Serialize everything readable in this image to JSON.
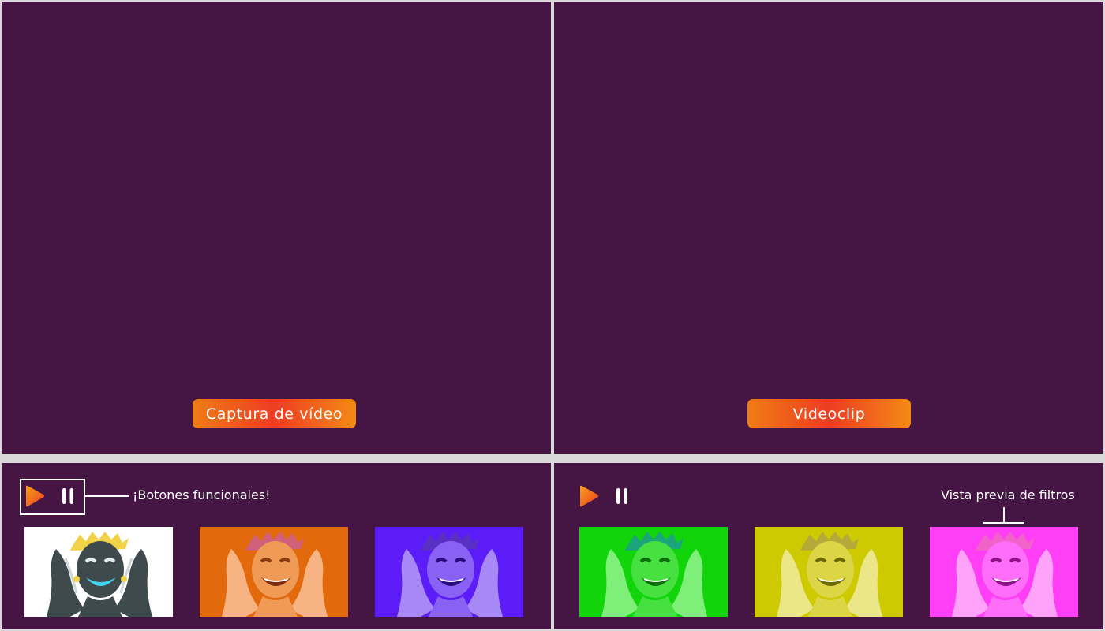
{
  "top_left": {
    "label": "Captura de vídeo"
  },
  "top_right": {
    "label": "Videoclip"
  },
  "bottom_left": {
    "controls": [
      "play-icon",
      "pause-icon"
    ],
    "note": "¡Botones funcionales!",
    "filters": [
      {
        "name": "inverted",
        "background": "#ffffff"
      },
      {
        "name": "orange",
        "background": "#e3690d"
      },
      {
        "name": "violet",
        "background": "#5b1cf7"
      }
    ]
  },
  "bottom_right": {
    "controls": [
      "play-icon",
      "pause-icon"
    ],
    "note": "Vista previa de filtros",
    "filters": [
      {
        "name": "green",
        "background": "#11d50a"
      },
      {
        "name": "yellow",
        "background": "#cdca02"
      },
      {
        "name": "magenta",
        "background": "#ff3ef6"
      }
    ]
  },
  "colors": {
    "panel_background": "#451543",
    "divider": "#d9d9d9",
    "accent_orange": "#f07d14",
    "accent_red": "#ed3c24"
  }
}
